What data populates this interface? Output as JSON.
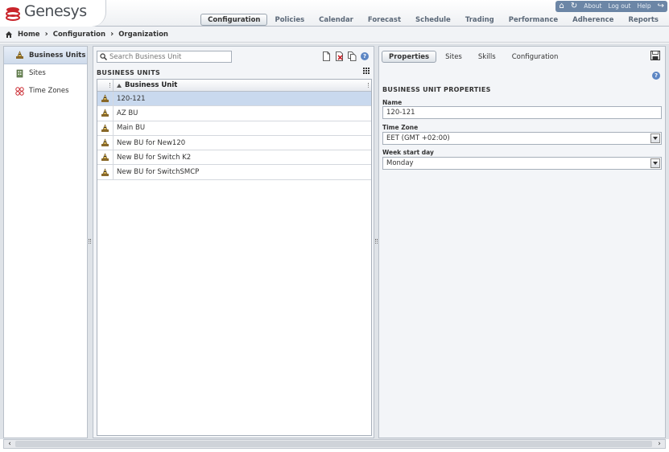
{
  "brand": {
    "name": "Genesys"
  },
  "utility": {
    "about": "About",
    "logout": "Log out",
    "help": "Help"
  },
  "nav": {
    "items": [
      "Configuration",
      "Policies",
      "Calendar",
      "Forecast",
      "Schedule",
      "Trading",
      "Performance",
      "Adherence",
      "Reports"
    ],
    "active": "Configuration"
  },
  "breadcrumb": [
    "Home",
    "Configuration",
    "Organization"
  ],
  "left_nav": {
    "items": [
      {
        "label": "Business Units",
        "icon": "business-unit-icon",
        "active": true
      },
      {
        "label": "Sites",
        "icon": "site-icon",
        "active": false
      },
      {
        "label": "Time Zones",
        "icon": "time-zone-icon",
        "active": false
      }
    ]
  },
  "middle": {
    "search_placeholder": "Search Business Unit",
    "section_title": "BUSINESS UNITS",
    "column_header": "Business Unit",
    "rows": [
      "120-121",
      "AZ BU",
      "Main BU",
      "New BU for New120",
      "New BU for Switch K2",
      "New BU for SwitchSMCP"
    ],
    "selected_row": "120-121"
  },
  "right": {
    "tabs": [
      "Properties",
      "Sites",
      "Skills",
      "Configuration"
    ],
    "active_tab": "Properties",
    "section_title": "BUSINESS UNIT PROPERTIES",
    "name_label": "Name",
    "name_value": "120-121",
    "timezone_label": "Time Zone",
    "timezone_value": "EET (GMT +02:00)",
    "week_start_label": "Week start day",
    "week_start_value": "Monday"
  },
  "colors": {
    "accent": "#6c86a6",
    "selected_row": "#c9d9ee",
    "panel_bg": "#dfe3e8"
  }
}
